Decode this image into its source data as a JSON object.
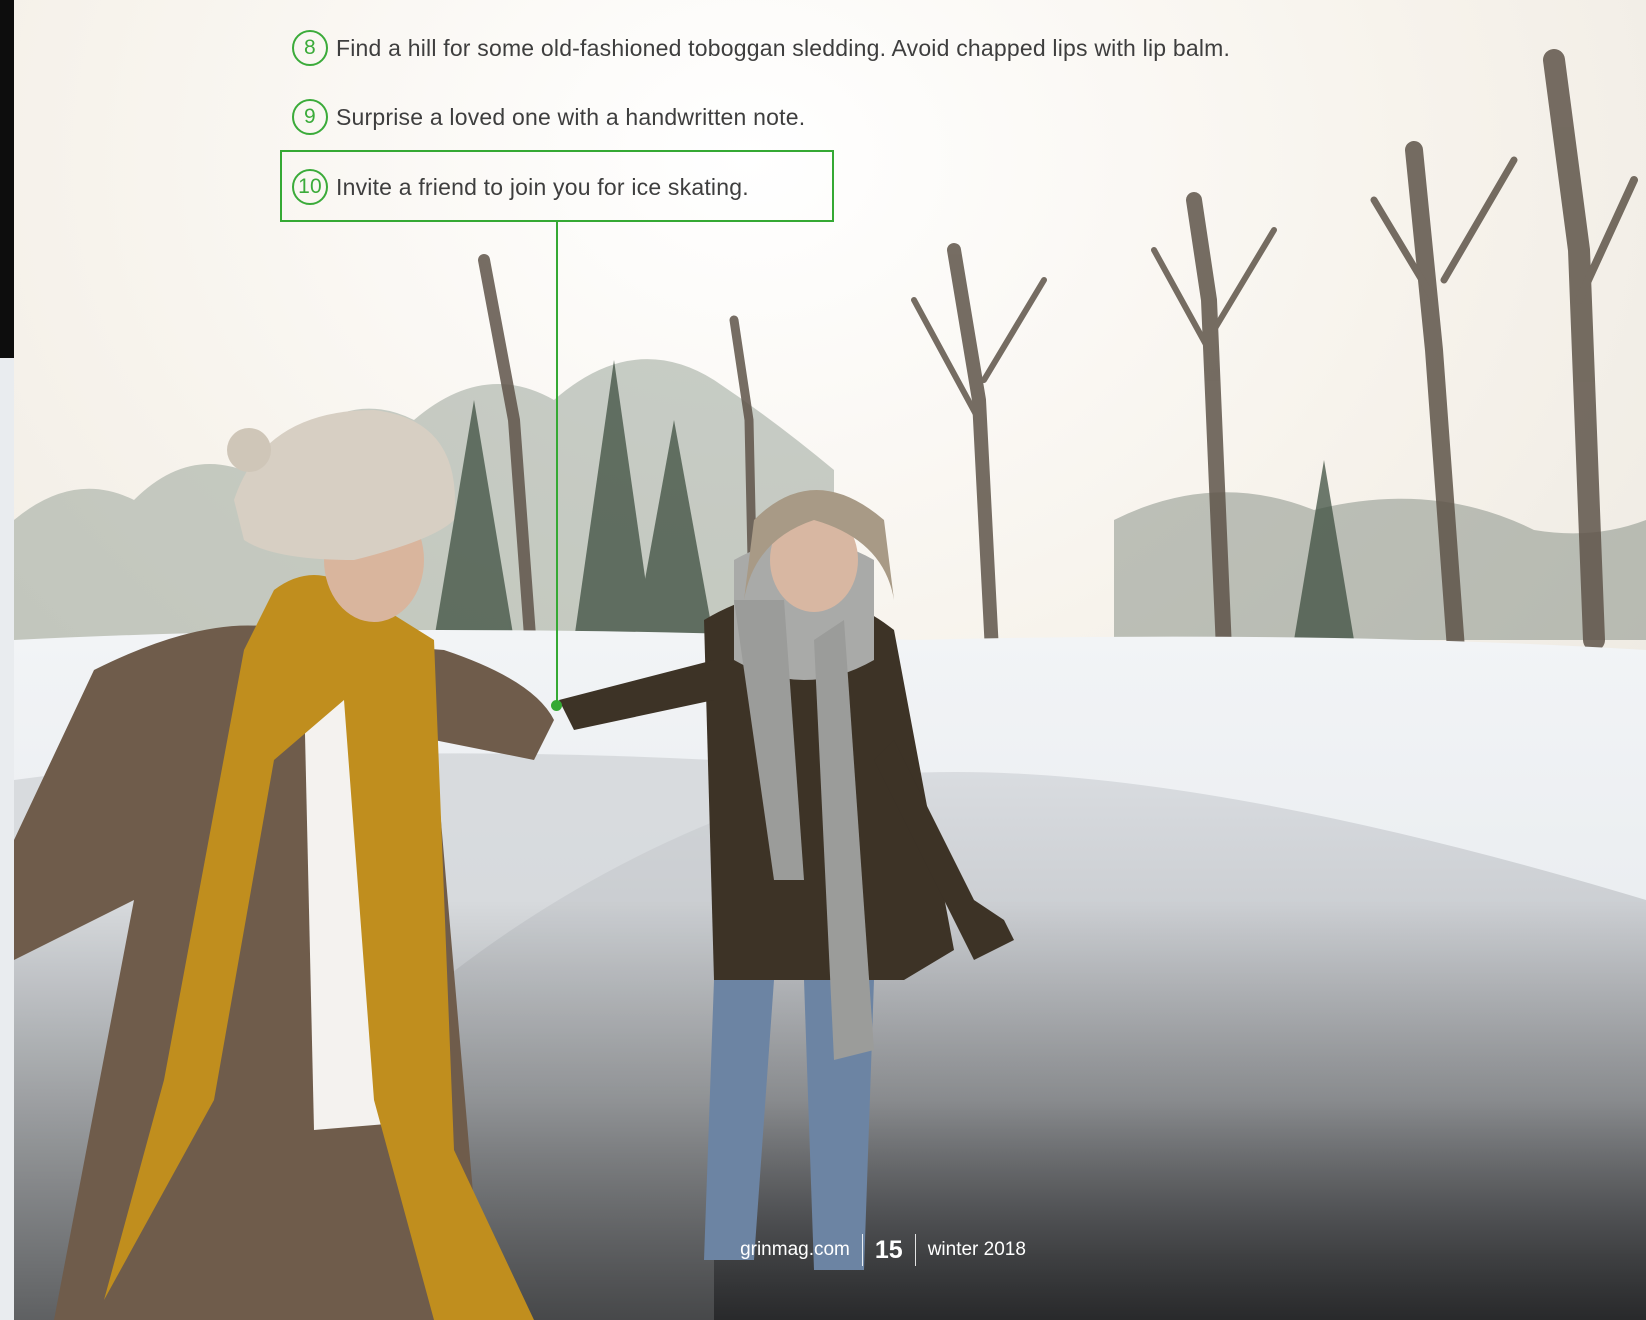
{
  "list": {
    "items": [
      {
        "number": "8",
        "text": "Find a hill for some old-fashioned toboggan sledding. Avoid chapped lips with lip balm."
      },
      {
        "number": "9",
        "text": "Surprise a loved one with a handwritten note."
      },
      {
        "number": "10",
        "text": "Invite a friend to join you for ice skating."
      }
    ]
  },
  "footer": {
    "site": "grinmag.com",
    "page_number": "15",
    "issue": "winter 2018"
  },
  "colors": {
    "accent_green": "#35a934",
    "body_text": "#3e3e3e"
  }
}
